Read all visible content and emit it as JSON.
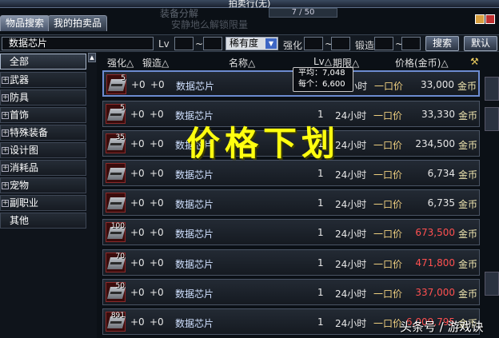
{
  "window": {
    "title": "拍卖行(无)"
  },
  "background": {
    "deco1": "装备分解",
    "deco2": "安静地么解锁限量",
    "hp": "7 / 50"
  },
  "tabs": [
    {
      "label": "物品搜索",
      "active": true
    },
    {
      "label": "我的拍卖品",
      "active": false
    }
  ],
  "search": {
    "query": "数据芯片",
    "lv_label": "Lv",
    "tilde": "~",
    "rarity_selected": "稀有度",
    "enhance_label": "强化",
    "forge_label": "锻造",
    "search_button": "搜索",
    "default_button": "默认"
  },
  "sidebar": {
    "items": [
      {
        "label": "全部",
        "expandable": false,
        "selected": true
      },
      {
        "label": "武器",
        "expandable": true
      },
      {
        "label": "防具",
        "expandable": true
      },
      {
        "label": "首饰",
        "expandable": true
      },
      {
        "label": "特殊装备",
        "expandable": true
      },
      {
        "label": "设计图",
        "expandable": true
      },
      {
        "label": "消耗品",
        "expandable": true
      },
      {
        "label": "宠物",
        "expandable": true
      },
      {
        "label": "副职业",
        "expandable": true
      },
      {
        "label": "其他",
        "expandable": false
      }
    ]
  },
  "columns": {
    "enhance": "强化△",
    "forge": "锻造△",
    "name": "名称△",
    "lv": "Lv△",
    "period": "期限△",
    "price": "价格(金币)△"
  },
  "tooltip": {
    "line1": "平均：7,048",
    "line2": "每个：6,600"
  },
  "overlay_text": "价格下划",
  "rows": [
    {
      "qty": "5",
      "enh": "+0",
      "forge": "+0",
      "name": "数据芯片",
      "lv": "1",
      "time": "24小时",
      "type": "一口价",
      "price": "33,000",
      "unit": "金币",
      "price_color": "#e6e6e6"
    },
    {
      "qty": "5",
      "enh": "+0",
      "forge": "+0",
      "name": "数据芯片",
      "lv": "1",
      "time": "24小时",
      "type": "一口价",
      "price": "33,330",
      "unit": "金币",
      "price_color": "#e6e6e6"
    },
    {
      "qty": "35",
      "enh": "+0",
      "forge": "+0",
      "name": "数据芯片",
      "lv": "1",
      "time": "24小时",
      "type": "一口价",
      "price": "234,500",
      "unit": "金币",
      "price_color": "#e6e6e6"
    },
    {
      "qty": "",
      "enh": "+0",
      "forge": "+0",
      "name": "数据芯片",
      "lv": "1",
      "time": "24小时",
      "type": "一口价",
      "price": "6,734",
      "unit": "金币",
      "price_color": "#e6e6e6"
    },
    {
      "qty": "",
      "enh": "+0",
      "forge": "+0",
      "name": "数据芯片",
      "lv": "1",
      "time": "24小时",
      "type": "一口价",
      "price": "6,735",
      "unit": "金币",
      "price_color": "#e6e6e6"
    },
    {
      "qty": "100",
      "enh": "+0",
      "forge": "+0",
      "name": "数据芯片",
      "lv": "1",
      "time": "24小时",
      "type": "一口价",
      "price": "673,500",
      "unit": "金币",
      "price_color": "#ff5050"
    },
    {
      "qty": "70",
      "enh": "+0",
      "forge": "+0",
      "name": "数据芯片",
      "lv": "1",
      "time": "24小时",
      "type": "一口价",
      "price": "471,800",
      "unit": "金币",
      "price_color": "#ff5050"
    },
    {
      "qty": "50",
      "enh": "+0",
      "forge": "+0",
      "name": "数据芯片",
      "lv": "1",
      "time": "24小时",
      "type": "一口价",
      "price": "337,000",
      "unit": "金币",
      "price_color": "#ff5050"
    },
    {
      "qty": "891",
      "enh": "+0",
      "forge": "+0",
      "name": "数据芯片",
      "lv": "1",
      "time": "24小时",
      "type": "一口价",
      "price": "6,009,795",
      "unit": "金币",
      "price_color": "#ff5050"
    }
  ],
  "watermark": "头条号 / 游戏诀"
}
